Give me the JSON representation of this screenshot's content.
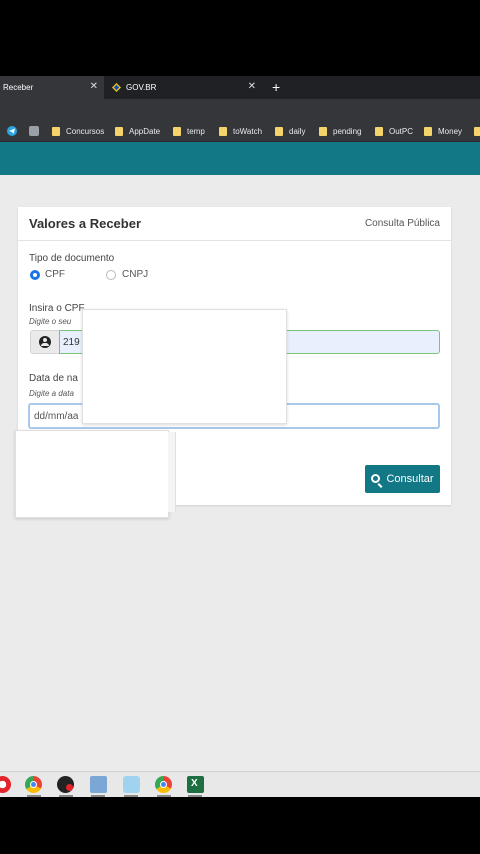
{
  "browser": {
    "tabs": [
      {
        "label": "Receber",
        "active": true
      },
      {
        "label": "GOV.BR",
        "active": false
      }
    ],
    "new_tab": "+",
    "close_glyph": "✕",
    "bookmarks": [
      "Concursos",
      "AppDate",
      "temp",
      "toWatch",
      "daily",
      "pending",
      "OutPC",
      "Money"
    ]
  },
  "form": {
    "title": "Valores a Receber",
    "public_link": "Consulta Pública",
    "doc_type_label": "Tipo de documento",
    "doc_options": [
      {
        "label": "CPF",
        "selected": true
      },
      {
        "label": "CNPJ",
        "selected": false
      }
    ],
    "cpf_label": "Insira o CPF",
    "cpf_hint": "Digite o seu",
    "cpf_value": "219",
    "date_label": "Data de na",
    "date_hint": "Digite a data",
    "date_placeholder": "dd/mm/aa",
    "submit_label": "Consultar"
  },
  "colors": {
    "brand_teal": "#137886",
    "radio_selected": "#1a73e8",
    "cpf_valid_border": "#7cc17c"
  },
  "taskbar_icons": [
    "opera-icon",
    "chrome-icon",
    "app-icon",
    "calculator-icon",
    "window-icon",
    "chrome-profile-icon",
    "excel-icon"
  ]
}
